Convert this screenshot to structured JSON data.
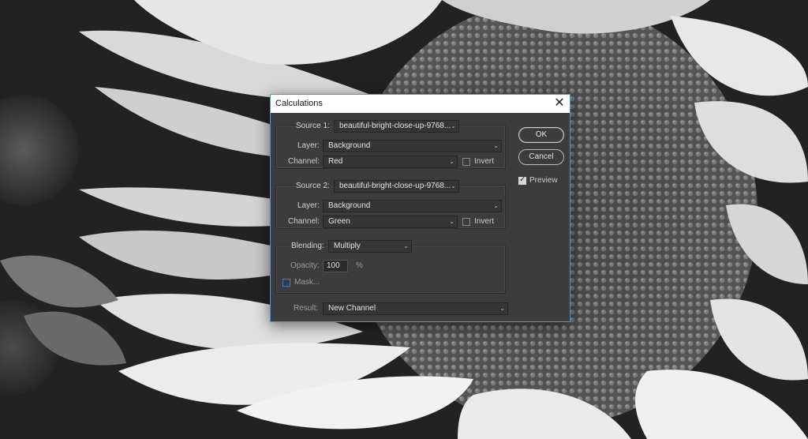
{
  "dialog": {
    "title": "Calculations",
    "close_glyph": "✕"
  },
  "source1": {
    "label": "Source 1:",
    "file": "beautiful-bright-close-up-9768...",
    "layer_label": "Layer:",
    "layer": "Background",
    "channel_label": "Channel:",
    "channel": "Red",
    "invert_label": "Invert",
    "invert_checked": false
  },
  "source2": {
    "label": "Source 2:",
    "file": "beautiful-bright-close-up-9768...",
    "layer_label": "Layer:",
    "layer": "Background",
    "channel_label": "Channel:",
    "channel": "Green",
    "invert_label": "Invert",
    "invert_checked": false
  },
  "blending": {
    "label": "Blending:",
    "mode": "Multiply",
    "opacity_label": "Opacity:",
    "opacity": "100",
    "opacity_unit": "%",
    "mask_label": "Mask..."
  },
  "result": {
    "label": "Result:",
    "value": "New Channel"
  },
  "buttons": {
    "ok": "OK",
    "cancel": "Cancel"
  },
  "preview": {
    "label": "Preview",
    "checked": true
  },
  "icons": {
    "dropdown": "chevron-down-icon",
    "close": "close-icon",
    "checkbox": "checkbox-icon"
  }
}
